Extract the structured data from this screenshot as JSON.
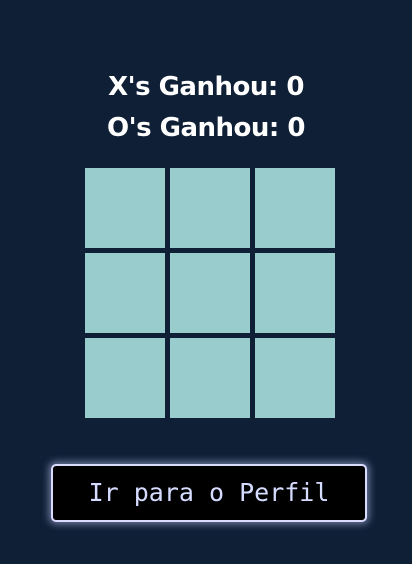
{
  "scoreboard": {
    "x_wins": "X's Ganhou: 0",
    "o_wins": "O's Ganhou: 0"
  },
  "board": {
    "cells": [
      "",
      "",
      "",
      "",
      "",
      "",
      "",
      "",
      ""
    ]
  },
  "actions": {
    "profile_button_label": "Ir para o Perfil"
  },
  "colors": {
    "background": "#0f1f36",
    "cell": "#99cccc",
    "button_background": "#000000",
    "button_border": "#d9dcff",
    "button_text": "#d6dcff"
  }
}
